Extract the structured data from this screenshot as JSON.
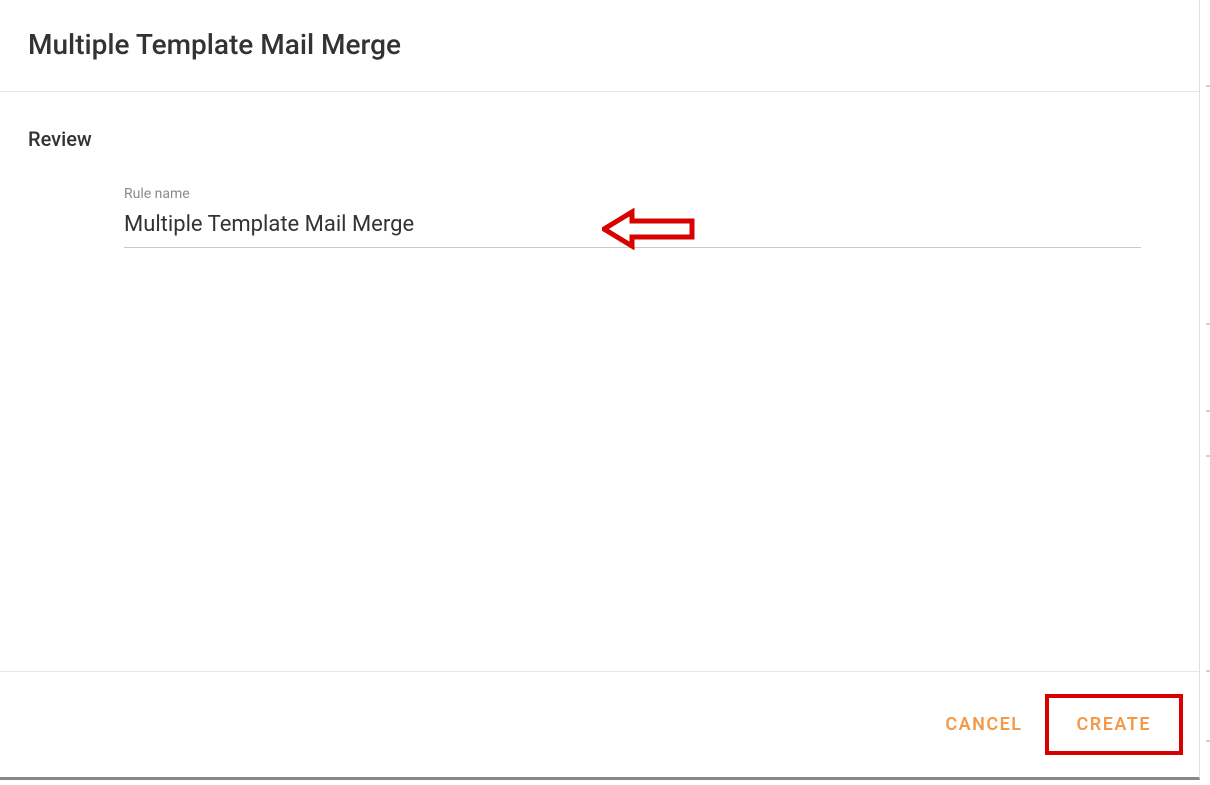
{
  "header": {
    "title": "Multiple Template Mail Merge"
  },
  "body": {
    "section_title": "Review",
    "rule_name_label": "Rule name",
    "rule_name_value": "Multiple Template Mail Merge"
  },
  "footer": {
    "cancel_label": "CANCEL",
    "create_label": "CREATE"
  },
  "annotation": {
    "arrow_color": "#D90000",
    "highlight_color": "#D90000"
  }
}
